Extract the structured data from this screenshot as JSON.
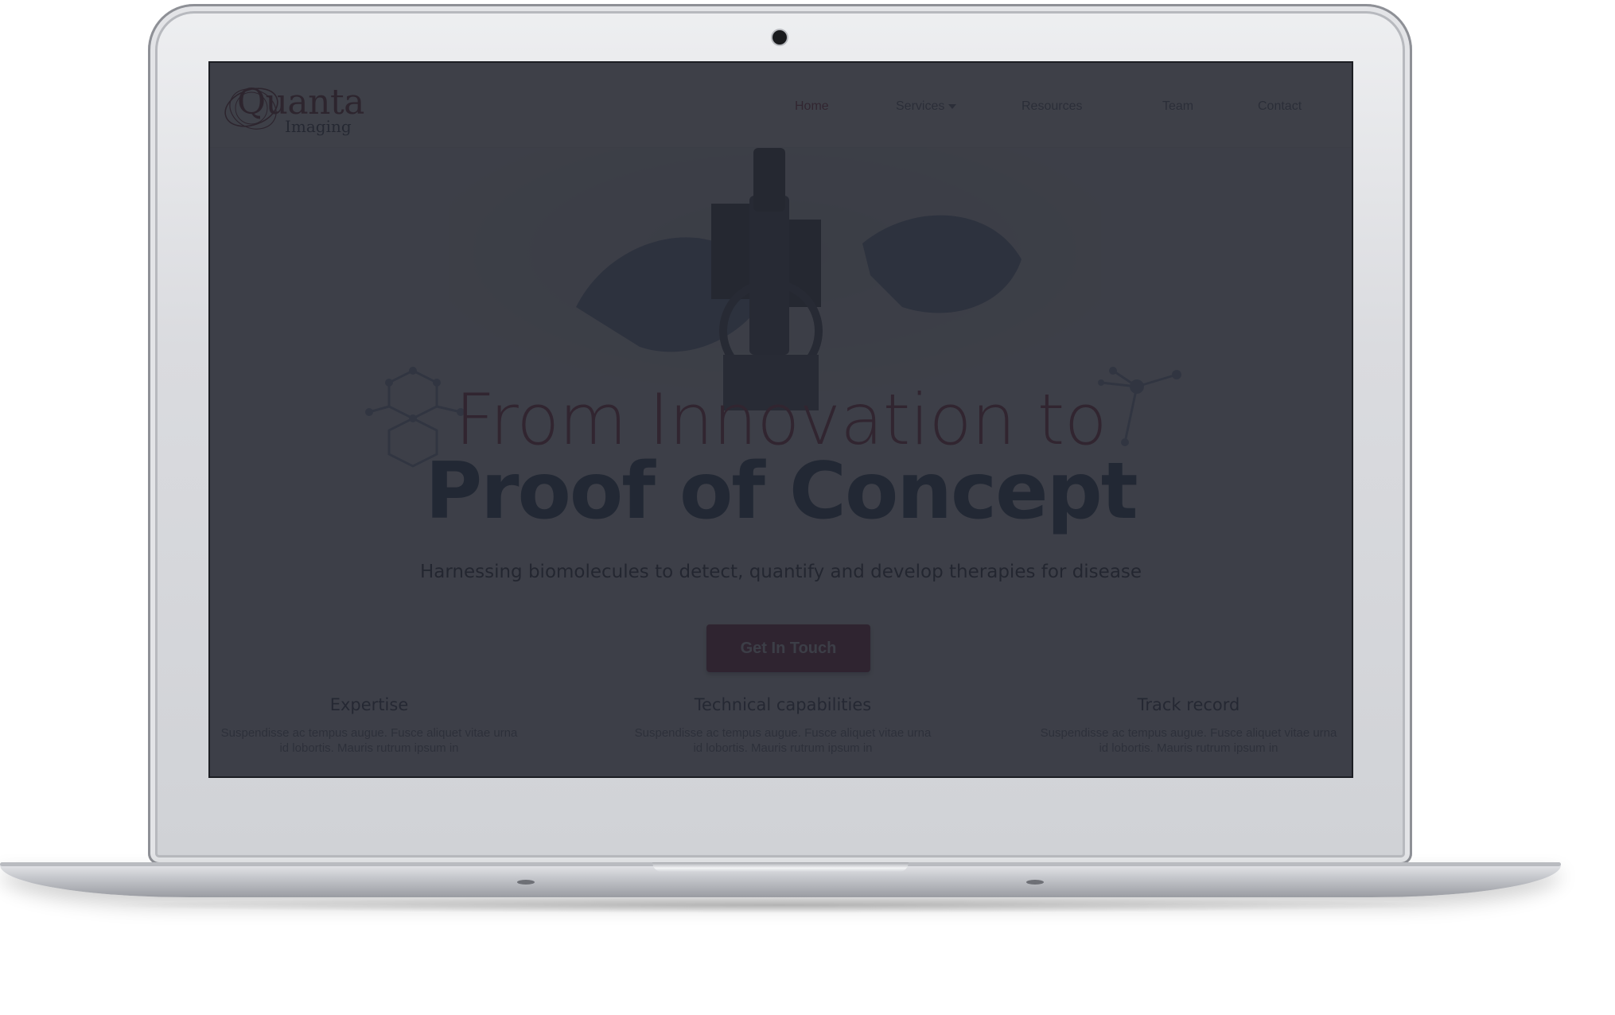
{
  "brand": {
    "name": "Quanta",
    "tagline": "Imaging"
  },
  "nav": {
    "items": [
      {
        "label": "Home",
        "active": true
      },
      {
        "label": "Services",
        "has_dropdown": true
      },
      {
        "label": "Resources"
      },
      {
        "label": "Team"
      },
      {
        "label": "Contact"
      }
    ]
  },
  "hero": {
    "line1": "From Innovation to",
    "line2": "Proof of Concept",
    "subtitle": "Harnessing biomolecules to detect, quantify and develop therapies for disease",
    "cta_label": "Get In Touch"
  },
  "features": [
    {
      "title": "Expertise",
      "text": "Suspendisse ac tempus augue. Fusce aliquet vitae urna id lobortis. Mauris rutrum ipsum in"
    },
    {
      "title": "Technical capabilities",
      "text": "Suspendisse ac tempus augue. Fusce aliquet vitae urna id lobortis. Mauris rutrum ipsum in"
    },
    {
      "title": "Track record",
      "text": "Suspendisse ac tempus augue. Fusce aliquet vitae urna id lobortis. Mauris rutrum ipsum in"
    }
  ],
  "colors": {
    "accent": "#8a1f33",
    "heading": "#163550",
    "overlay": "#242730",
    "device": "#d6d8dc"
  },
  "icons": {
    "logo": "orbit-logo-mark",
    "hero_image": "microscope-photo",
    "decor_left": "hexagon-molecule-icon",
    "decor_right": "node-molecule-icon",
    "dropdown": "chevron-down-icon",
    "camera": "camera-dot"
  }
}
